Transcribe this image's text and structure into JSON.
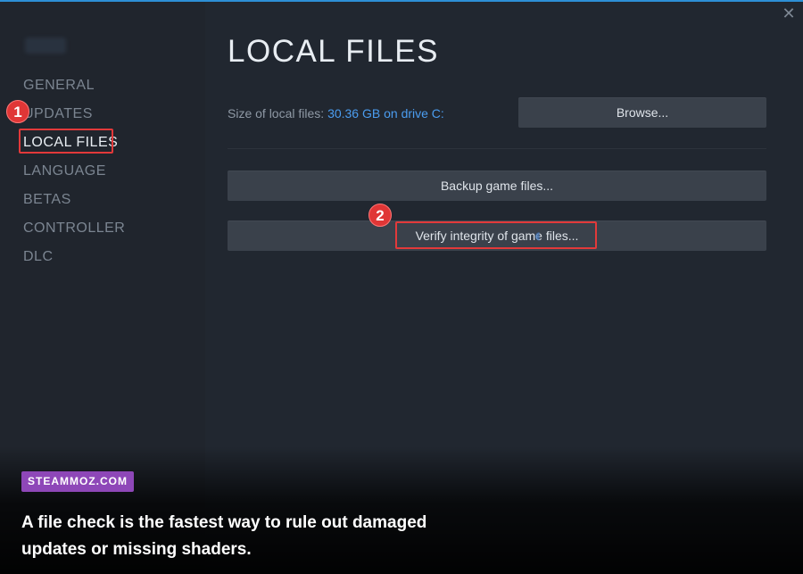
{
  "sidebar": {
    "items": [
      {
        "label": "GENERAL"
      },
      {
        "label": "UPDATES"
      },
      {
        "label": "LOCAL FILES"
      },
      {
        "label": "LANGUAGE"
      },
      {
        "label": "BETAS"
      },
      {
        "label": "CONTROLLER"
      },
      {
        "label": "DLC"
      }
    ],
    "active": "LOCAL FILES"
  },
  "main": {
    "title": "LOCAL FILES",
    "size_label": "Size of local files:",
    "size_value": "30.36 GB on drive C:",
    "browse_label": "Browse...",
    "backup_label": "Backup game files...",
    "verify_label": "Verify integrity of game files..."
  },
  "annotations": {
    "step1": "1",
    "step2": "2",
    "highlight_color": "#e2393a"
  },
  "window": {
    "close_icon": "close-icon"
  },
  "overlay": {
    "brand": "STEAMMOZ.COM",
    "caption": "A file check is the fastest way to rule out damaged updates or missing shaders.",
    "brand_color": "#8e47b8"
  },
  "colors": {
    "accent_link": "#4b9df0",
    "top_line": "#2d8fd6"
  }
}
